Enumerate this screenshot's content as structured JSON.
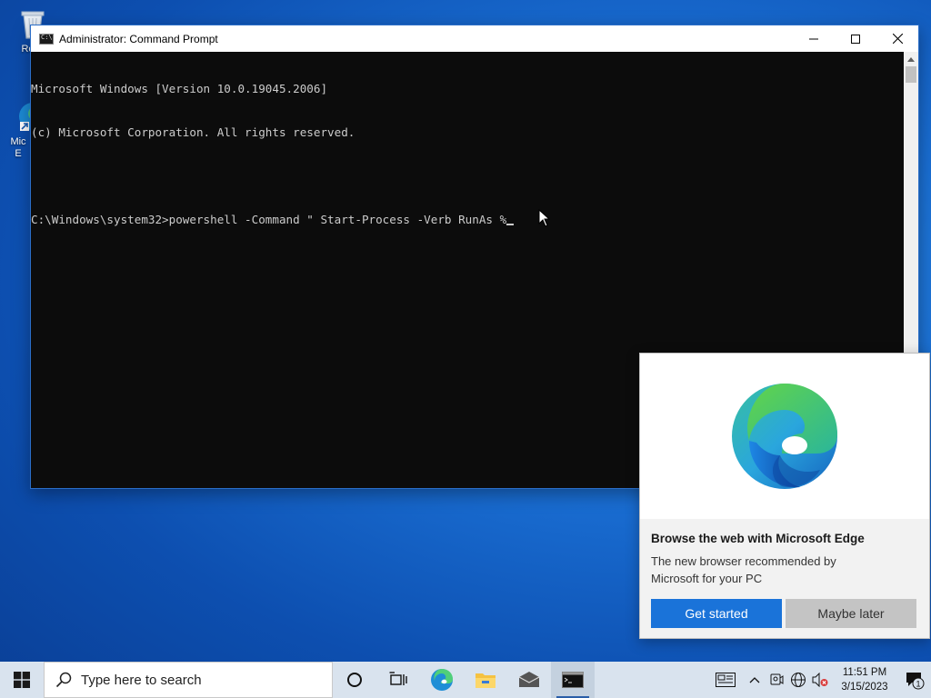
{
  "desktop": {
    "icons": [
      {
        "label": "Recy",
        "icon": "recycle-bin-icon"
      },
      {
        "label": "Mic E",
        "icon": "edge-shortcut-icon"
      }
    ]
  },
  "cmd_window": {
    "title": "Administrator: Command Prompt",
    "lines": [
      "Microsoft Windows [Version 10.0.19045.2006]",
      "(c) Microsoft Corporation. All rights reserved.",
      "",
      "C:\\Windows\\system32>powershell -Command \" Start-Process -Verb RunAs %"
    ]
  },
  "edge_popup": {
    "heading": "Browse the web with Microsoft Edge",
    "description": "The new browser recommended by Microsoft for your PC",
    "primary_button": "Get started",
    "secondary_button": "Maybe later"
  },
  "taskbar": {
    "search_placeholder": "Type here to search",
    "apps": [
      "task-view",
      "edge",
      "file-explorer",
      "mail",
      "command-prompt"
    ],
    "clock_time": "11:51 PM",
    "clock_date": "3/15/2023",
    "notification_count": "1"
  },
  "colors": {
    "accent": "#1a73d9",
    "console_bg": "#0c0c0c",
    "console_text": "#cccccc",
    "taskbar": "#d9e3ee"
  }
}
